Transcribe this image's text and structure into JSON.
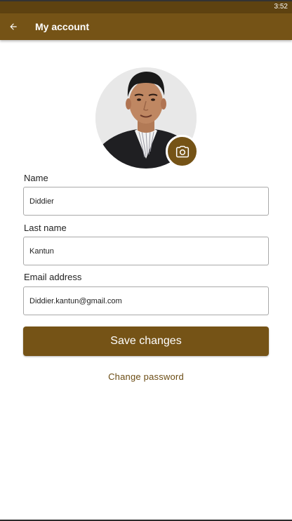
{
  "status_bar": {
    "time": "3:52"
  },
  "app_bar": {
    "title": "My account",
    "back_icon": "arrow-left-icon"
  },
  "profile": {
    "photo_icon": "camera-icon"
  },
  "form": {
    "name": {
      "label": "Name",
      "value": "Diddier"
    },
    "last_name": {
      "label": "Last name",
      "value": "Kantun"
    },
    "email": {
      "label": "Email address",
      "value": "Diddier.kantun@gmail.com"
    }
  },
  "actions": {
    "save_label": "Save changes",
    "change_password_label": "Change password"
  },
  "colors": {
    "primary": "#755316",
    "status_bar": "#5e4210",
    "link": "#6b4c14"
  }
}
